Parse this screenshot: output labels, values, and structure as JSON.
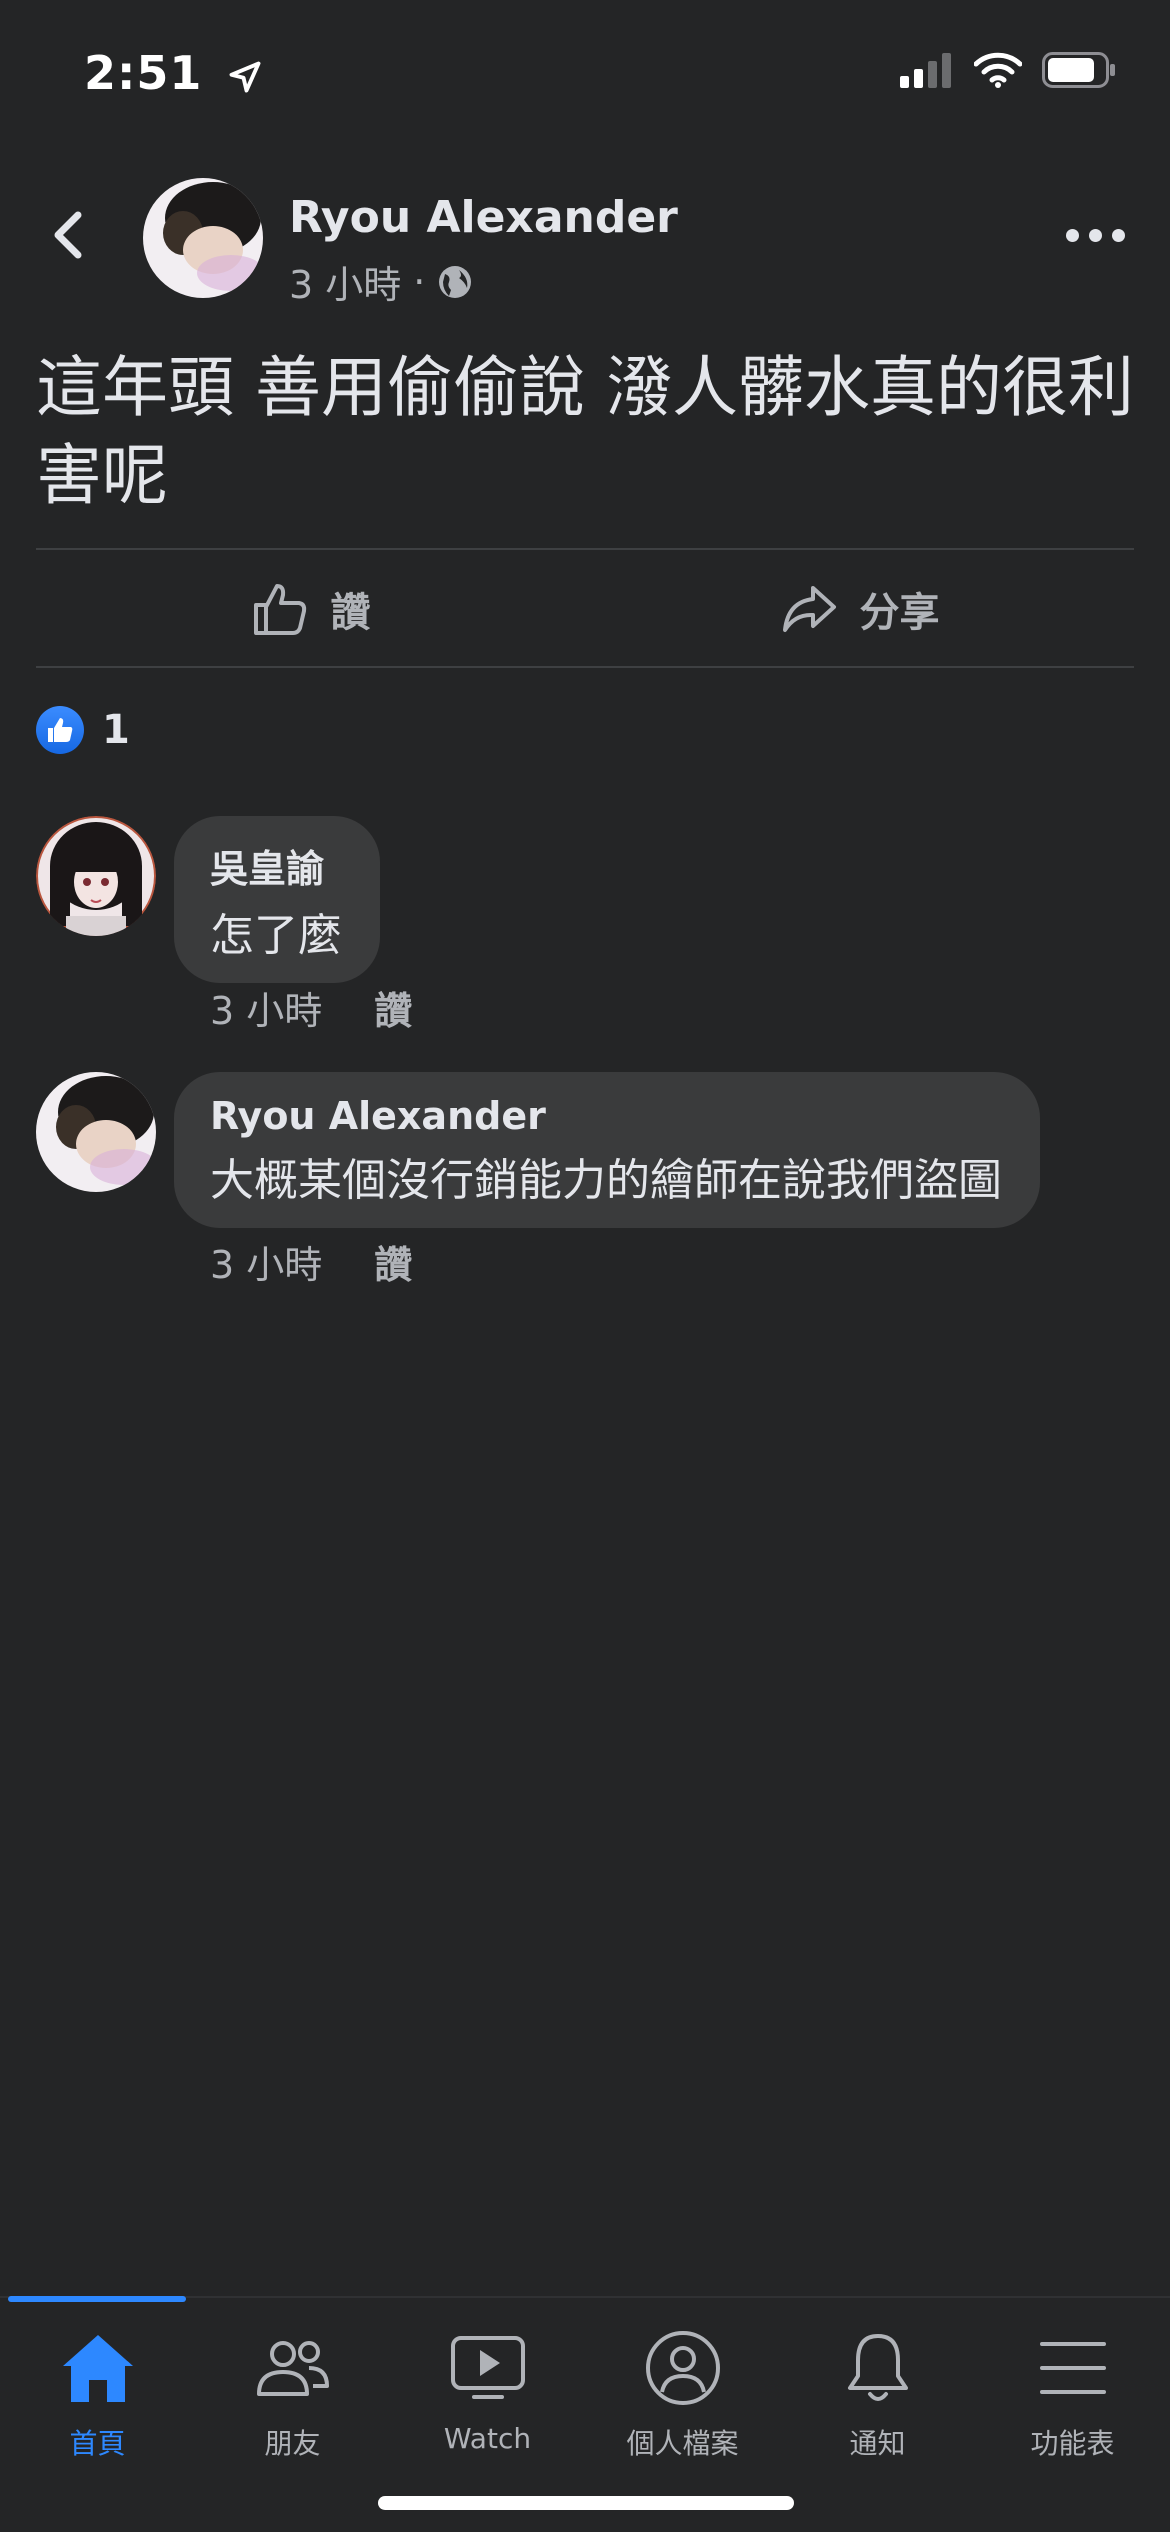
{
  "status_bar": {
    "time": "2:51"
  },
  "post": {
    "author": "Ryou Alexander",
    "time": "3 小時",
    "separator": "·",
    "text": "這年頭 善用偷偷說 潑人髒水真的很利害呢"
  },
  "actions": {
    "like": "讚",
    "share": "分享"
  },
  "reactions": {
    "count": "1"
  },
  "comments": [
    {
      "name": "吳皇諭",
      "text": "怎了麼",
      "time": "3 小時",
      "like": "讚"
    },
    {
      "name": "Ryou Alexander",
      "text": "大概某個沒行銷能力的繪師在說我們盜圖",
      "time": "3 小時",
      "like": "讚"
    }
  ],
  "tabbar": {
    "tabs": [
      {
        "label": "首頁",
        "icon": "home-icon",
        "active": true
      },
      {
        "label": "朋友",
        "icon": "friends-icon"
      },
      {
        "label": "Watch",
        "icon": "watch-icon"
      },
      {
        "label": "個人檔案",
        "icon": "profile-icon"
      },
      {
        "label": "通知",
        "icon": "bell-icon"
      },
      {
        "label": "功能表",
        "icon": "menu-icon"
      }
    ]
  },
  "colors": {
    "background": "#242526",
    "accent": "#2d88ff",
    "bubble": "#3a3b3c",
    "secondary_text": "#b0b3b8"
  }
}
